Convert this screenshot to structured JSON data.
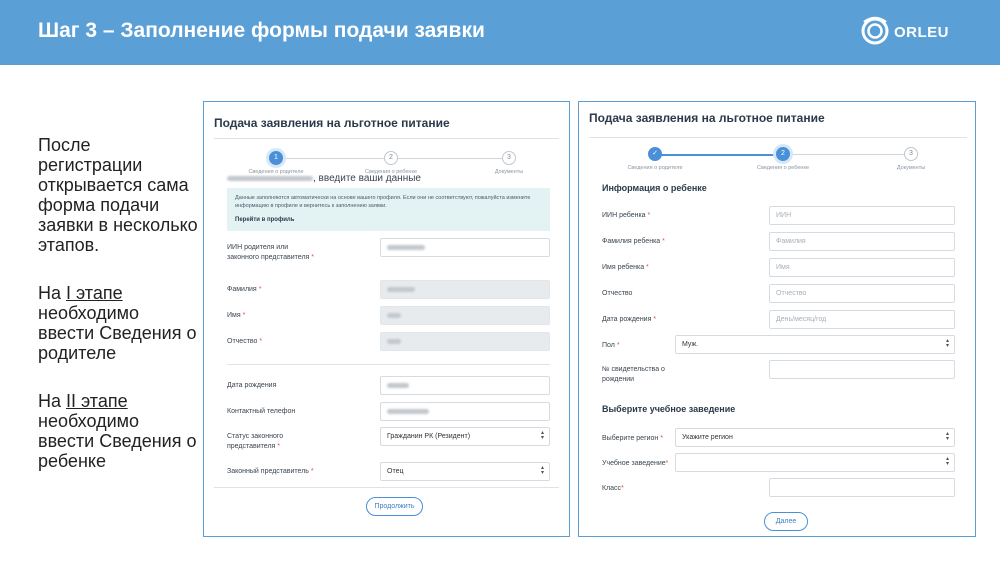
{
  "header": {
    "title": "Шаг 3 – Заполнение формы подачи заявки",
    "logo_text": "ORLEU"
  },
  "sidebar": {
    "intro": "После регистрации открывается сама форма подачи заявки в несколько этапов.",
    "stage1_prefix": "На ",
    "stage1_link": "I этапе",
    "stage1_rest": "необходимо ввести Сведения о родителе",
    "stage2_prefix": "На ",
    "stage2_link": "II этапе",
    "stage2_rest": "необходимо ввести Сведения о ребенке"
  },
  "form1": {
    "title": "Подача заявления на льготное питание",
    "steps": [
      {
        "num": "1",
        "label": "Сведения о родителе"
      },
      {
        "num": "2",
        "label": "Сведения о ребенке"
      },
      {
        "num": "3",
        "label": "Документы"
      }
    ],
    "greeting_suffix": ", введите ваши данные",
    "info_text": "Данные заполняются автоматически на основе вашего профиля. Если они не соответствуют, пожалуйста измените информацию в профиле и вернитесь к заполнению заявки.",
    "info_link": "Перейти в профиль",
    "fields": {
      "iin_label": "ИИН родителя или законного представителя",
      "surname_label": "Фамилия",
      "name_label": "Имя",
      "patronymic_label": "Отчество",
      "birth_label": "Дата рождения",
      "phone_label": "Контактный телефон",
      "status_label": "Статус законного представителя",
      "status_value": "Гражданин РК (Резидент)",
      "rep_label": "Законный представитель",
      "rep_value": "Отец"
    },
    "continue_button": "Продолжить"
  },
  "form2": {
    "title": "Подача заявления на льготное питание",
    "steps": [
      {
        "num": "✓",
        "label": "Сведения о родителе"
      },
      {
        "num": "2",
        "label": "Сведения о ребенке"
      },
      {
        "num": "3",
        "label": "Документы"
      }
    ],
    "child_section": "Информация о ребенке",
    "fields": {
      "iin_label": "ИИН ребенка",
      "iin_placeholder": "ИИН",
      "surname_label": "Фамилия ребенка",
      "surname_placeholder": "Фамилия",
      "name_label": "Имя ребенка",
      "name_placeholder": "Имя",
      "patronymic_label": "Отчество",
      "patronymic_placeholder": "Отчество",
      "birth_label": "Дата рождения",
      "birth_placeholder": "День/месяц/год",
      "gender_label": "Пол",
      "gender_value": "Муж.",
      "cert_label": "№ свидетельства о рождении"
    },
    "school_section": "Выберите учебное заведение",
    "school_fields": {
      "region_label": "Выберите регион",
      "region_value": "Укажите регион",
      "institution_label": "Учебное заведение",
      "class_label": "Класс"
    },
    "next_button": "Далее"
  }
}
